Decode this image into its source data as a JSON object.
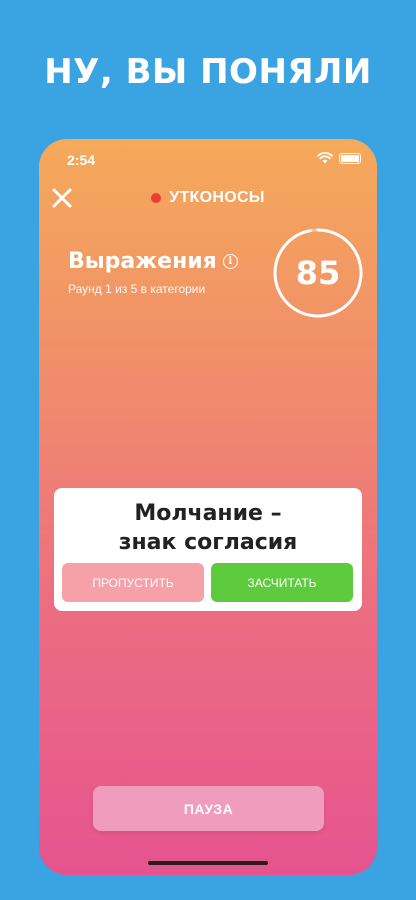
{
  "headline": "НУ, ВЫ ПОНЯЛИ",
  "status_bar": {
    "time": "2:54"
  },
  "team": {
    "name": "УТКОНОСЫ",
    "dot_color": "#ee3b34"
  },
  "category": {
    "title": "Выражения",
    "info_icon": "i",
    "round_info": "Раунд 1 из 5 в категории"
  },
  "timer": {
    "value": "85",
    "progress": 0.97
  },
  "card": {
    "line1": "Молчание –",
    "line2": "знак согласия",
    "skip_label": "ПРОПУСТИТЬ",
    "count_label": "ЗАСЧИТАТЬ"
  },
  "pause_label": "ПАУЗА",
  "colors": {
    "background": "#3aa3e2",
    "gradient_top": "#f5aa5a",
    "gradient_bottom": "#e6548f",
    "skip_button": "#f6a0a7",
    "count_button": "#5ecb3e",
    "pause_button": "#f09cbd"
  }
}
